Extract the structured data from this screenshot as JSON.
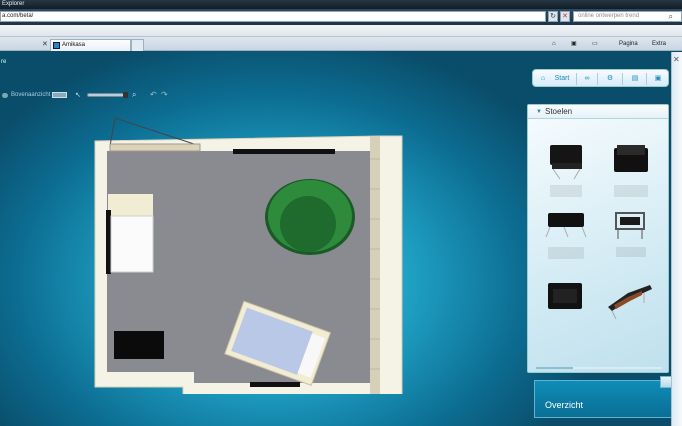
{
  "browser": {
    "title": "Explorer",
    "url": "a.com/beta/",
    "search_placeholder": "online ontwerpen trend",
    "tab_title": "Amikasa",
    "commands": {
      "home": "⌂",
      "feeds": "▣",
      "print": "▭",
      "pagina": "Pagina",
      "extra": "Extra"
    }
  },
  "app": {
    "page_label": "re",
    "view_label": "Bovenaanzicht",
    "topbar": {
      "start_label": "Start"
    },
    "panel": {
      "title": "Stoelen"
    },
    "overview_label": "Overzicht"
  }
}
